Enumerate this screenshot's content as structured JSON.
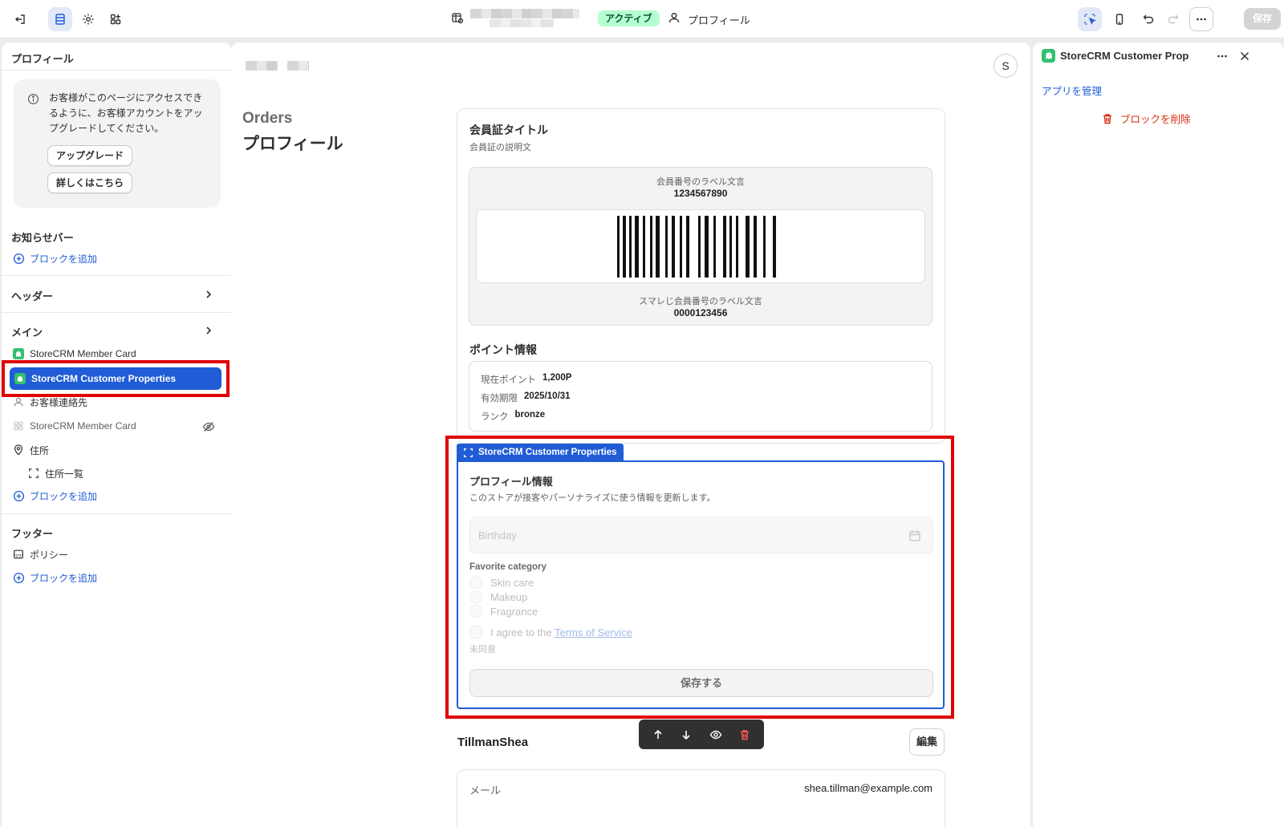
{
  "topbar": {
    "status_badge": "アクティブ",
    "profile_label": "プロフィール",
    "save_label": "保存"
  },
  "left": {
    "title": "プロフィール",
    "upgrade_message": "お客様がこのページにアクセスできるように、お客様アカウントをアップグレードしてください。",
    "upgrade_button": "アップグレード",
    "learn_more_button": "詳しくはこちら",
    "announcement_title": "お知らせバー",
    "add_block": "ブロックを追加",
    "header_title": "ヘッダー",
    "main_title": "メイン",
    "main_items": [
      {
        "label": "StoreCRM Member Card"
      },
      {
        "label": "StoreCRM Customer Properties"
      },
      {
        "label": "お客様連絡先"
      },
      {
        "label": "StoreCRM Member Card"
      },
      {
        "label": "住所"
      },
      {
        "label": "住所一覧"
      }
    ],
    "footer_title": "フッター",
    "footer_items": [
      {
        "label": "ポリシー"
      }
    ]
  },
  "center": {
    "avatar_letter": "S",
    "orders_heading": "Orders",
    "page_heading": "プロフィール",
    "member_card": {
      "title": "会員証タイトル",
      "description": "会員証の説明文",
      "number_label": "会員番号のラベル文言",
      "number": "1234567890",
      "smaregi_label": "スマレじ会員番号のラベル文言",
      "smaregi_number": "0000123456",
      "points_title": "ポイント情報",
      "points": [
        {
          "label": "現在ポイント",
          "value": "1,200P"
        },
        {
          "label": "有効期限",
          "value": "2025/10/31"
        },
        {
          "label": "ランク",
          "value": "bronze"
        }
      ]
    },
    "block_tag": "StoreCRM Customer Properties",
    "properties": {
      "title": "プロフィール情報",
      "description": "このストアが接客やパーソナライズに使う情報を更新します。",
      "birthday_placeholder": "Birthday",
      "favorite_label": "Favorite category",
      "options": [
        "Skin care",
        "Makeup",
        "Fragrance"
      ],
      "agree_prefix": "I agree to the ",
      "terms_link": "Terms of Service",
      "agree_status": "未同意",
      "save_button": "保存する"
    },
    "customer_name": "TillmanShea",
    "edit_button": "編集",
    "email_label": "メール",
    "email_value": "shea.tillman@example.com"
  },
  "right": {
    "title": "StoreCRM Customer Prop",
    "manage_app": "アプリを管理",
    "delete_block": "ブロックを削除"
  },
  "colors": {
    "accent": "#1f5cd6",
    "app_green": "#34c06f",
    "danger": "#d72c0d",
    "highlight_red": "#e00000",
    "badge_bg": "#b4fed2"
  }
}
